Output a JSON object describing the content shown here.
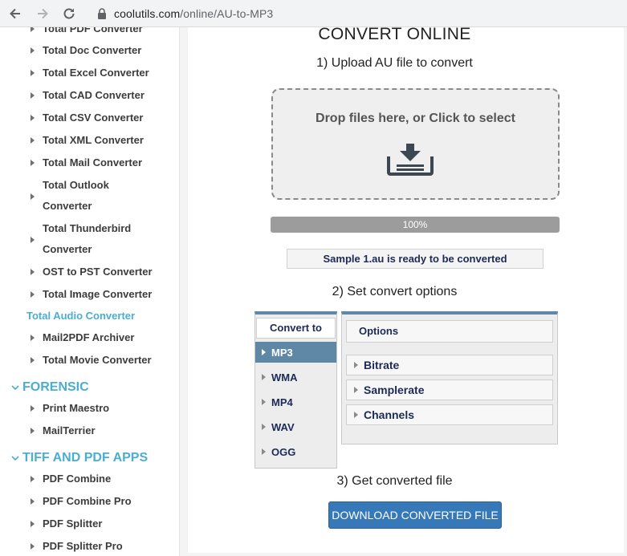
{
  "browser": {
    "url_host": "coolutils.com",
    "url_path": "/online/AU-to-MP3"
  },
  "sidebar": {
    "items": [
      {
        "label": "Total PDF Converter"
      },
      {
        "label": "Total Doc Converter"
      },
      {
        "label": "Total Excel Converter"
      },
      {
        "label": "Total CAD Converter"
      },
      {
        "label": "Total CSV Converter"
      },
      {
        "label": "Total XML Converter"
      },
      {
        "label": "Total Mail Converter"
      },
      {
        "label": "Total Outlook Converter",
        "line1": "Total Outlook",
        "line2": "Converter"
      },
      {
        "label": "Total Thunderbird Converter",
        "line1": "Total Thunderbird",
        "line2": "Converter"
      },
      {
        "label": "OST to PST Converter"
      },
      {
        "label": "Total Image Converter"
      },
      {
        "label": "Total Audio Converter"
      },
      {
        "label": "Mail2PDF Archiver"
      },
      {
        "label": "Total Movie Converter"
      }
    ],
    "sections": [
      {
        "title": "FORENSIC",
        "items": [
          "Print Maestro",
          "MailTerrier"
        ]
      },
      {
        "title": "TIFF AND PDF APPS",
        "items": [
          "PDF Combine",
          "PDF Combine Pro",
          "PDF Splitter",
          "PDF Splitter Pro"
        ]
      }
    ],
    "active_color": "#4aaed0"
  },
  "main": {
    "heading": "CONVERT ONLINE",
    "step1": "1) Upload AU file to convert",
    "dropzone_text": "Drop files here, or Click to select",
    "progress_text": "100%",
    "progress_value": 1.0,
    "ready_text": "Sample 1.au is ready to be converted",
    "step2": "2) Set convert options",
    "convert_to": {
      "header": "Convert to",
      "formats": [
        "MP3",
        "WMA",
        "MP4",
        "WAV",
        "OGG"
      ],
      "selected": "MP3"
    },
    "options": {
      "header": "Options",
      "rows": [
        "Bitrate",
        "Samplerate",
        "Channels"
      ]
    },
    "step3": "3) Get converted file",
    "download_label": "DOWNLOAD CONVERTED FILE",
    "accent_color": "#3779b8"
  }
}
